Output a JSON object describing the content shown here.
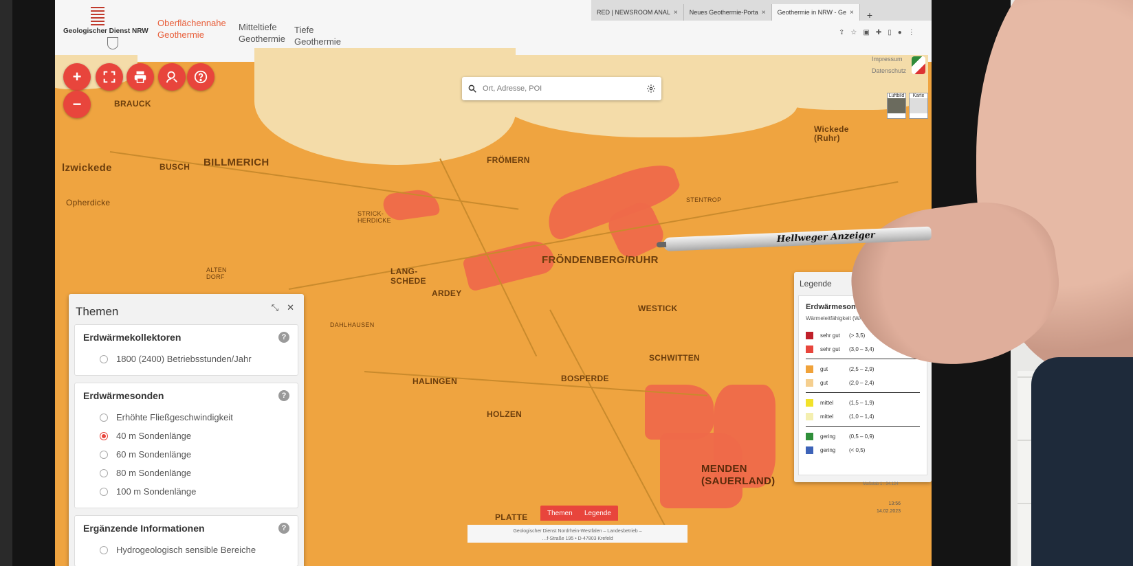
{
  "browser": {
    "tabs": [
      {
        "label": "RED | NEWSROOM ANAL",
        "active": false
      },
      {
        "label": "Neues Geothermie-Porta",
        "active": false
      },
      {
        "label": "Geothermie in NRW - Ge",
        "active": true
      }
    ],
    "new_tab": "+"
  },
  "header": {
    "logo_text": "Geologischer Dienst NRW",
    "nav": [
      {
        "label": "Oberflächennahe Geothermie",
        "active": true
      },
      {
        "label": "Mitteltiefe Geothermie",
        "active": false
      },
      {
        "label": "Tiefe Geothermie",
        "active": false
      }
    ],
    "impressum": "Impressum",
    "datenschutz": "Datenschutz"
  },
  "controls": {
    "zoom_in": "+",
    "zoom_out": "−",
    "fullscreen_icon": "fullscreen-icon",
    "print_icon": "print-icon",
    "locate_icon": "locate-person-icon",
    "help_icon": "help-icon"
  },
  "search": {
    "placeholder": "Ort, Adresse, POI"
  },
  "basemaps": {
    "luftbild": "Luftbild",
    "karte": "Karte"
  },
  "map": {
    "places": {
      "brauck": "BRAUCK",
      "izwickede": "lzwickede",
      "busch": "BUSCH",
      "billmerich": "BILLMERICH",
      "opherdicke": "Opherdicke",
      "froemern": "FRÖMERN",
      "frondenberg": "FRÖNDENBERG/RUHR",
      "langschede": "LANG-\nSCHEDE",
      "ardey": "ARDEY",
      "westick": "WESTICK",
      "wickede": "Wickede\n(Ruhr)",
      "halingen": "HALINGEN",
      "bosperde": "BOSPERDE",
      "holzen": "HOLZEN",
      "schwitten": "SCHWITTEN",
      "menden": "MENDEN\n(SAUERLAND)",
      "dahlhausen": "DAHLHAUSEN",
      "platte": "PLATTE",
      "alten_dorf": "ALTEN\nDORF",
      "stentrop": "STENTROP",
      "strickherdicke": "STRICK-\nHERDICKE"
    }
  },
  "themen": {
    "title": "Themen",
    "groups": [
      {
        "title": "Erdwärmekollektoren",
        "options": [
          {
            "label": "1800 (2400) Betriebsstunden/Jahr",
            "selected": false
          }
        ]
      },
      {
        "title": "Erdwärmesonden",
        "options": [
          {
            "label": "Erhöhte Fließgeschwindigkeit",
            "selected": false
          },
          {
            "label": "40 m Sondenlänge",
            "selected": true
          },
          {
            "label": "60 m Sondenlänge",
            "selected": false
          },
          {
            "label": "80 m Sondenlänge",
            "selected": false
          },
          {
            "label": "100 m Sondenlänge",
            "selected": false
          }
        ]
      },
      {
        "title": "Ergänzende Informationen",
        "options": [
          {
            "label": "Hydrogeologisch sensible Bereiche",
            "selected": false
          }
        ]
      }
    ]
  },
  "legende": {
    "title": "Legende",
    "section": "Erdwärmesonden",
    "subtitle": "Wärmeleitfähigkeit (W/m K)",
    "rows": [
      {
        "label": "sehr gut",
        "range": "(> 3,5)",
        "color": "#c0202a"
      },
      {
        "label": "sehr gut",
        "range": "(3,0 – 3,4)",
        "color": "#e8453c"
      },
      {
        "label": "gut",
        "range": "(2,5 – 2,9)",
        "color": "#f0a23a"
      },
      {
        "label": "gut",
        "range": "(2,0 – 2,4)",
        "color": "#f5cf8f"
      },
      {
        "label": "mittel",
        "range": "(1,5 – 1,9)",
        "color": "#f2e22a"
      },
      {
        "label": "mittel",
        "range": "(1,0 – 1,4)",
        "color": "#f4efb0"
      },
      {
        "label": "gering",
        "range": "(0,5 – 0,9)",
        "color": "#2f8f3a"
      },
      {
        "label": "gering",
        "range": "(< 0,5)",
        "color": "#3d63b8"
      }
    ]
  },
  "bottom": {
    "themen_btn": "Themen",
    "legende_btn": "Legende",
    "footer_line1": "Geologischer Dienst Nordrhein-Westfalen – Landesbetrieb –",
    "footer_line2": "…f-Straße 195 • D-47803 Krefeld",
    "scale": "Maßstab 1 : 34.124",
    "time": "13:56",
    "date": "14.02.2023"
  },
  "pen": {
    "label": "Hellweger Anzeiger"
  },
  "colors": {
    "accent": "#e8453c",
    "map_base": "#efa440",
    "map_pale": "#f4dca9",
    "map_red": "#ee6a4a"
  }
}
